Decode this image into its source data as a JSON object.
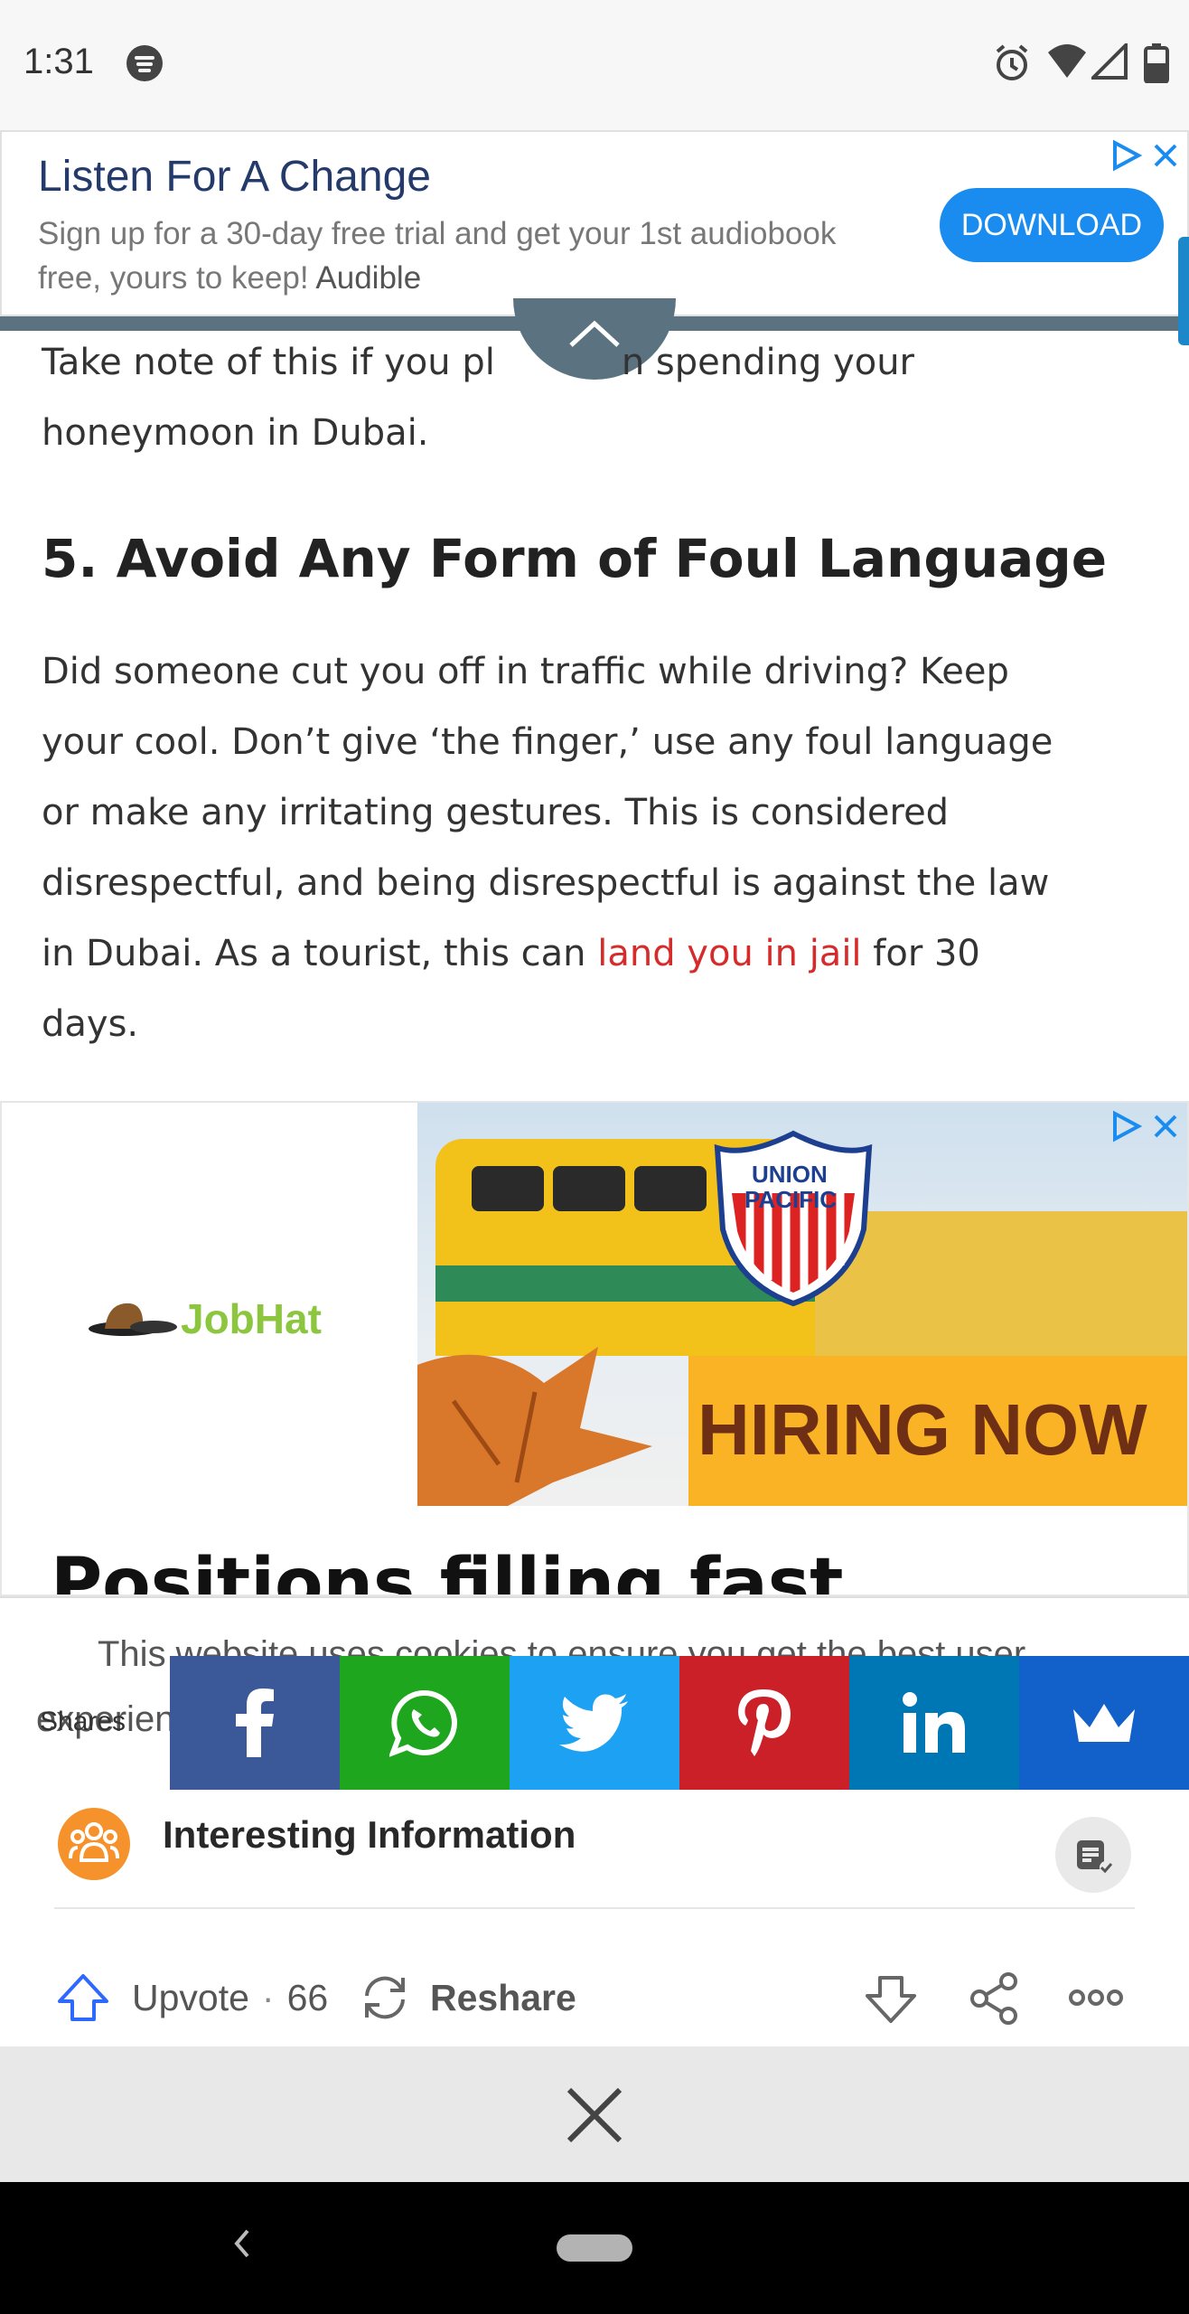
{
  "status_bar": {
    "time": "1:31",
    "icons": [
      "spotify-icon",
      "alarm-icon",
      "wifi-icon",
      "signal-icon",
      "battery-icon"
    ]
  },
  "top_ad": {
    "title": "Listen For A Change",
    "description": "Sign up for a 30-day free trial and get your 1st audiobook free, yours to keep!",
    "brand": "Audible",
    "button": "DOWNLOAD",
    "colors": {
      "button": "#1a8cf0",
      "title": "#243a6b"
    }
  },
  "article": {
    "intro_line1_before": "Take note of this if you pl",
    "intro_line1_after": "n spending your",
    "intro_line2": "honeymoon in Dubai.",
    "heading": "5. Avoid Any Form of Foul Language",
    "body_lines": [
      "Did someone cut you off in traffic while driving? Keep",
      "your cool. Don’t give ‘the finger,’ use any foul language",
      "or make any irritating gestures. This is considered",
      "disrespectful, and being disrespectful is against the law"
    ],
    "body_line5_before": "in Dubai. As a tourist, this can ",
    "body_link": "land you in jail",
    "body_line5_after": " for 30",
    "body_line6": "days.",
    "link_color": "#d62b2b"
  },
  "job_ad": {
    "logo_text": "JobHat",
    "badge_line1": "UNION",
    "badge_line2": "PACIFIC",
    "banner": "HIRING NOW",
    "headline": "Positions filling fast"
  },
  "cookie": {
    "line1": "This website uses cookies to ensure you get the best user",
    "line2_visible": "experien"
  },
  "share": {
    "label": "Shares",
    "buttons": [
      {
        "name": "facebook",
        "color": "#3b5998"
      },
      {
        "name": "whatsapp",
        "color": "#1ea61e"
      },
      {
        "name": "twitter",
        "color": "#1da1f2"
      },
      {
        "name": "pinterest",
        "color": "#cb2027"
      },
      {
        "name": "linkedin",
        "color": "#0077b5"
      },
      {
        "name": "crown",
        "color": "#1260c9"
      }
    ]
  },
  "card": {
    "space_name": "Interesting Information",
    "upvote_label": "Upvote",
    "upvote_sep": "·",
    "upvote_count": "66",
    "reshare_label": "Reshare"
  }
}
